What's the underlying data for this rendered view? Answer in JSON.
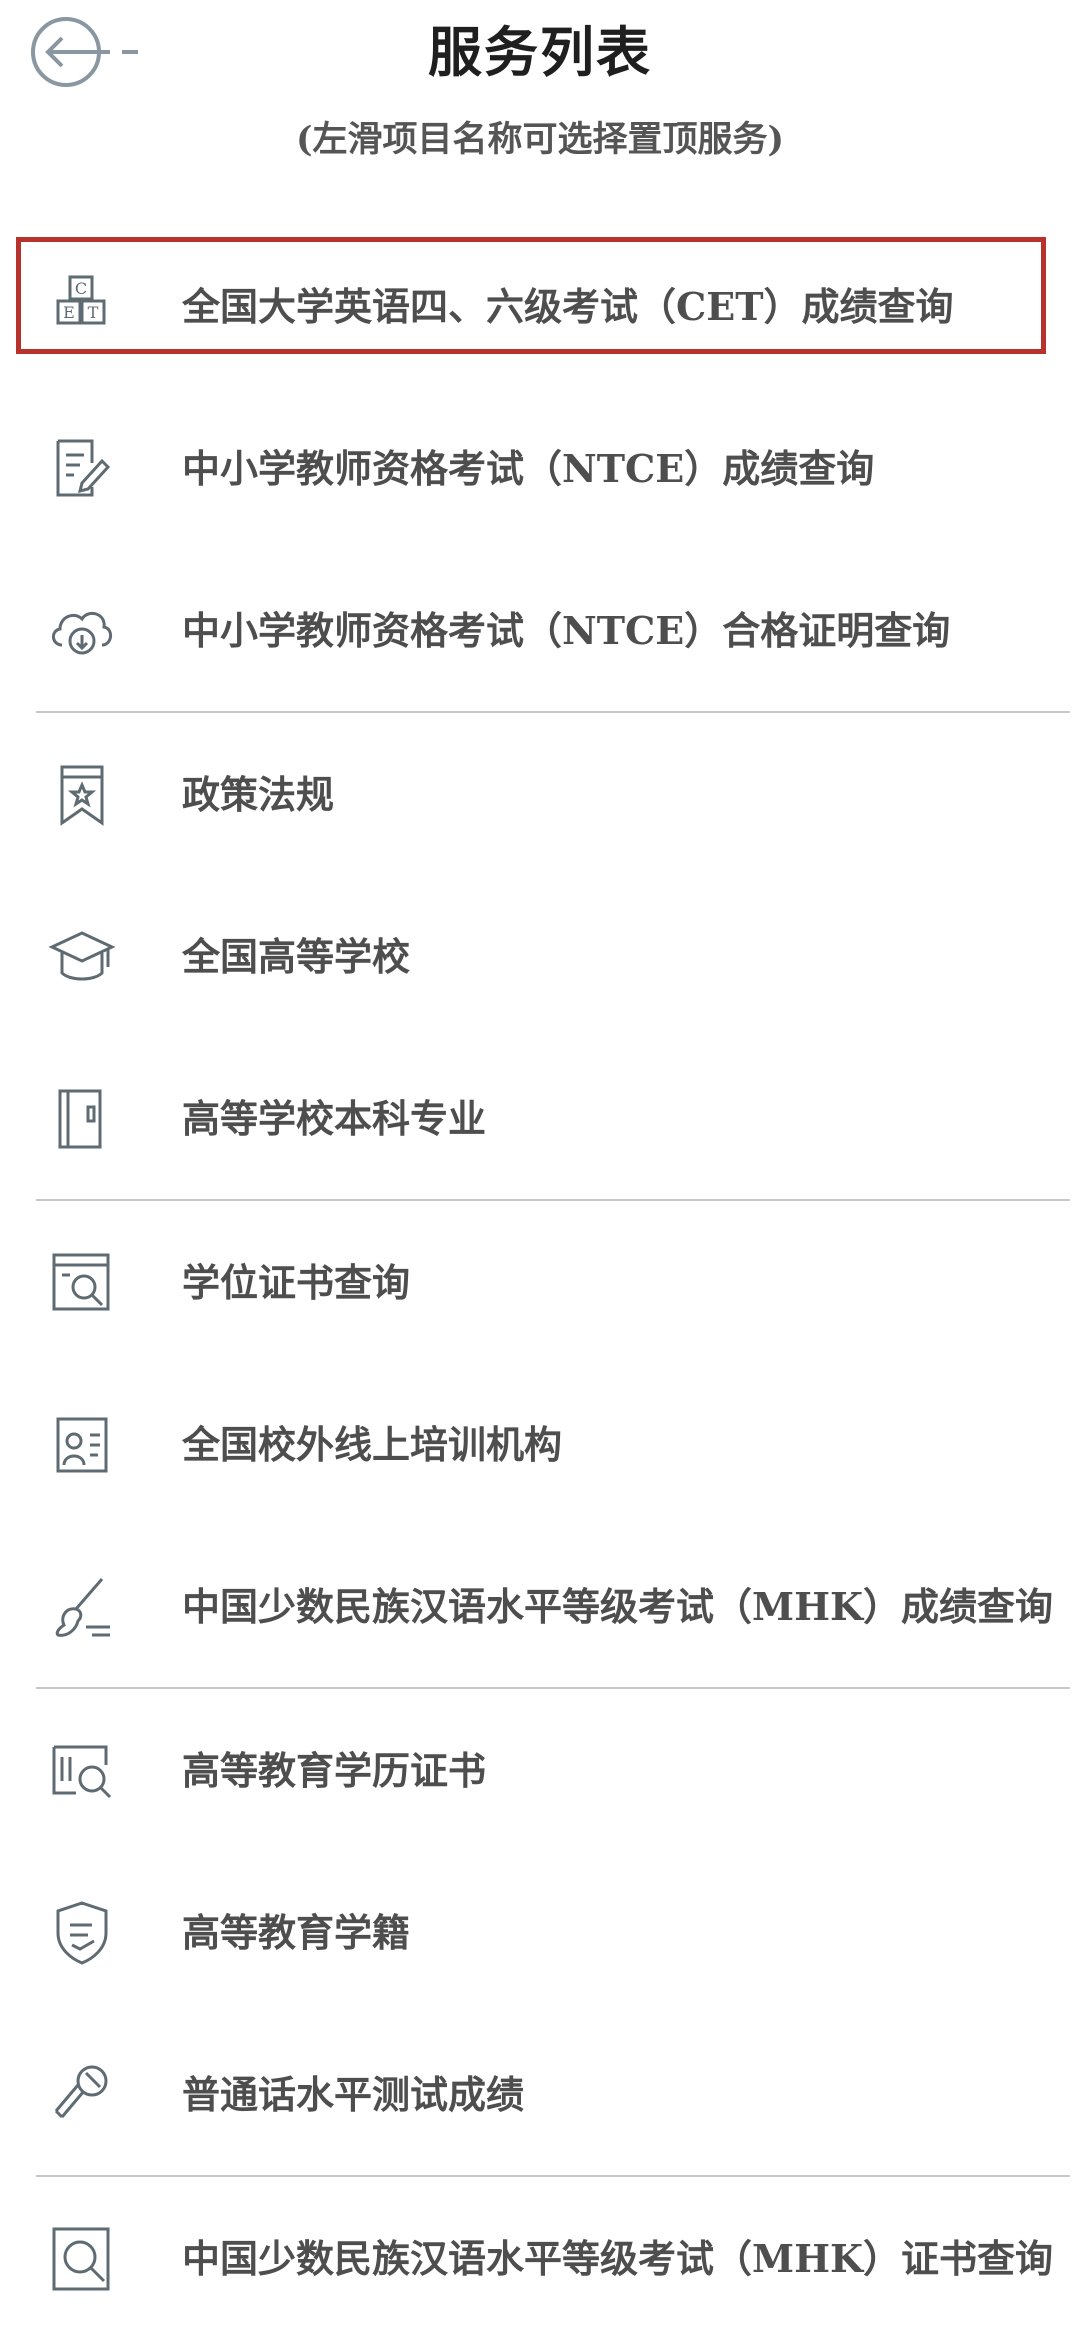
{
  "header": {
    "title": "服务列表",
    "subtitle": "(左滑项目名称可选择置顶服务)"
  },
  "colors": {
    "highlight_border": "#b8322d",
    "icon_stroke": "#5f6b72",
    "divider": "#c8c8c8"
  },
  "items": [
    {
      "label": "全国大学英语四、六级考试（CET）成绩查询",
      "icon": "cet-blocks-icon",
      "highlighted": true
    },
    {
      "label": "中小学教师资格考试（NTCE）成绩查询",
      "icon": "edit-document-icon"
    },
    {
      "label": "中小学教师资格考试（NTCE）合格证明查询",
      "icon": "cloud-download-icon"
    },
    {
      "label": "政策法规",
      "icon": "bookmark-star-icon"
    },
    {
      "label": "全国高等学校",
      "icon": "graduation-cap-icon"
    },
    {
      "label": "高等学校本科专业",
      "icon": "book-icon"
    },
    {
      "label": "学位证书查询",
      "icon": "search-document-icon"
    },
    {
      "label": "全国校外线上培训机构",
      "icon": "profile-card-icon"
    },
    {
      "label": "中国少数民族汉语水平等级考试（MHK）成绩查询",
      "icon": "brush-icon"
    },
    {
      "label": "高等教育学历证书",
      "icon": "certificate-search-icon"
    },
    {
      "label": "高等教育学籍",
      "icon": "shield-list-icon"
    },
    {
      "label": "普通话水平测试成绩",
      "icon": "microphone-icon"
    },
    {
      "label": "中国少数民族汉语水平等级考试（MHK）证书查询",
      "icon": "magnifier-frame-icon"
    }
  ]
}
